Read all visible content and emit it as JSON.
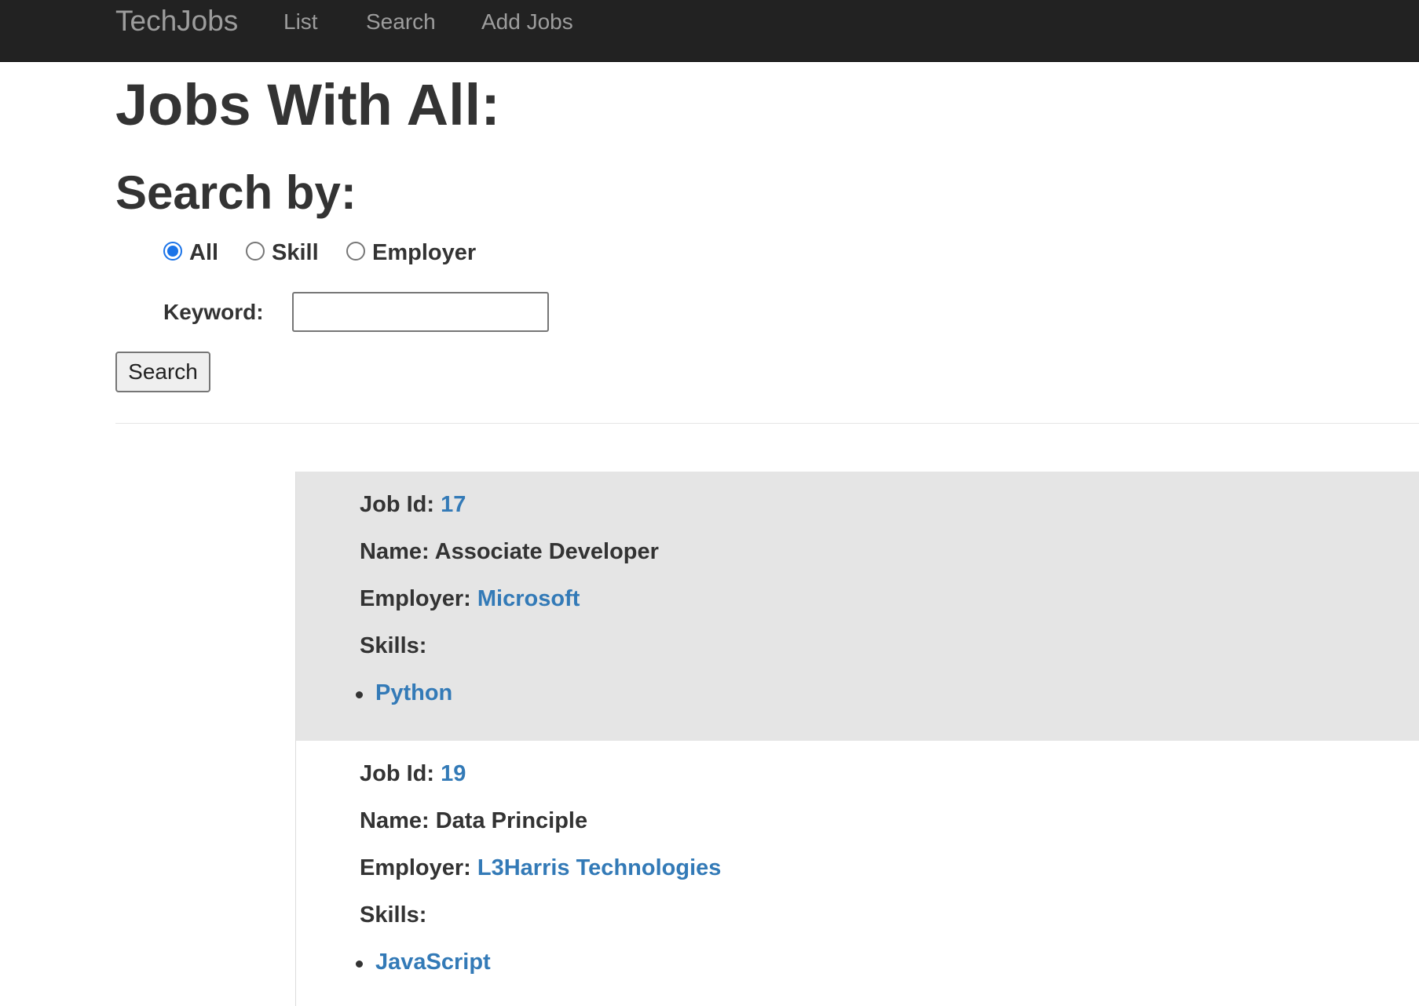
{
  "navbar": {
    "brand": "TechJobs",
    "links": [
      {
        "label": "List"
      },
      {
        "label": "Search"
      },
      {
        "label": "Add Jobs"
      }
    ]
  },
  "page": {
    "title": "Jobs With All:"
  },
  "search": {
    "heading": "Search by:",
    "options": [
      {
        "label": "All",
        "checked": true
      },
      {
        "label": "Skill",
        "checked": false
      },
      {
        "label": "Employer",
        "checked": false
      }
    ],
    "keyword_label": "Keyword:",
    "keyword_value": "",
    "button_label": "Search"
  },
  "jobs": [
    {
      "id_label": "Job Id:",
      "id": "17",
      "name_label": "Name:",
      "name": "Associate Developer",
      "employer_label": "Employer:",
      "employer": "Microsoft",
      "skills_label": "Skills:",
      "skills": [
        "Python"
      ]
    },
    {
      "id_label": "Job Id:",
      "id": "19",
      "name_label": "Name:",
      "name": "Data Principle",
      "employer_label": "Employer:",
      "employer": "L3Harris Technologies",
      "skills_label": "Skills:",
      "skills": [
        "JavaScript"
      ]
    }
  ],
  "colors": {
    "navbar_bg": "#222222",
    "nav_text": "#9d9d9d",
    "link": "#337ab7",
    "highlight_row": "#e5e5e5",
    "radio_checked": "#1a73e8"
  }
}
